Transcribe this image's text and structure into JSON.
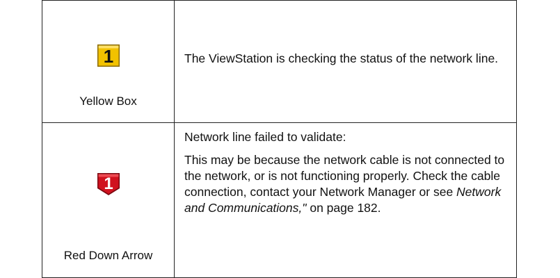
{
  "table": {
    "rows": [
      {
        "icon": "yellow-box-1-icon",
        "icon_color": "#f2c200",
        "icon_text": "1",
        "label": "Yellow Box",
        "description": "The ViewStation is checking the status of the network line."
      },
      {
        "icon": "red-down-arrow-1-icon",
        "icon_color": "#d0121f",
        "icon_text": "1",
        "label": "Red Down Arrow",
        "description_title": "Network line failed to validate:",
        "description_body_before": "This may be because the network cable is not connected to the network, or is not functioning properly. Check the cable connection, contact your Network Manager or see ",
        "description_body_italic": "Network and Communications,\"",
        "description_body_after": " on page 182."
      }
    ]
  }
}
